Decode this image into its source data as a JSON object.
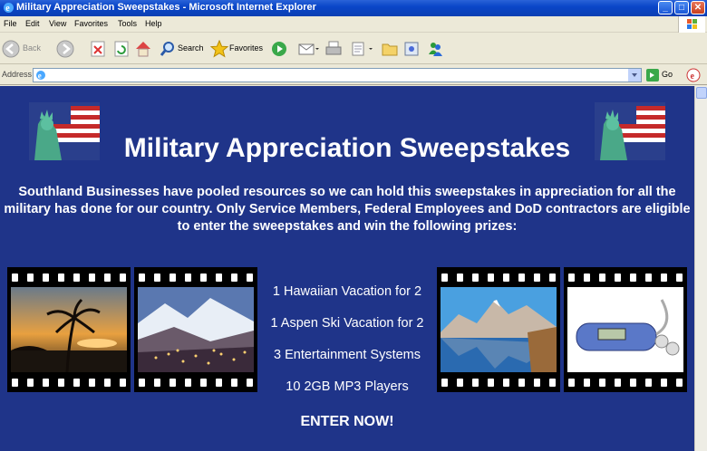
{
  "window": {
    "title": "Military Appreciation Sweepstakes - Microsoft Internet Explorer",
    "minimize": "_",
    "maximize": "□",
    "close": "✕"
  },
  "menu": [
    "File",
    "Edit",
    "View",
    "Favorites",
    "Tools",
    "Help"
  ],
  "toolbar": {
    "back_label": "Back",
    "search_label": "Search",
    "favorites_label": "Favorites"
  },
  "address": {
    "label": "Address",
    "value": "",
    "go_label": "Go"
  },
  "page": {
    "headline": "Military Appreciation Sweepstakes",
    "intro": "Southland Businesses have pooled resources so we can hold this sweepstakes in appreciation for all the military has done for our country. Only Service Members, Federal Employees and DoD contractors are eligible to enter the sweepstakes and win the following prizes:",
    "prizes": [
      "1 Hawaiian Vacation for 2",
      "1 Aspen Ski Vacation for 2",
      "3 Entertainment Systems",
      "10 2GB MP3 Players"
    ],
    "cta": "ENTER NOW!"
  },
  "colors": {
    "page_background": "#1f3489",
    "text": "#ffffff",
    "titlebar": "#0a46c8"
  },
  "icons": [
    "internet-explorer-icon",
    "back-arrow-icon",
    "forward-arrow-icon",
    "stop-icon",
    "refresh-icon",
    "home-icon",
    "search-icon",
    "favorites-star-icon",
    "media-icon",
    "mail-icon",
    "print-icon",
    "edit-icon",
    "folder-icon",
    "messenger-icon",
    "go-arrow-icon",
    "statue-of-liberty-flag-icon"
  ]
}
